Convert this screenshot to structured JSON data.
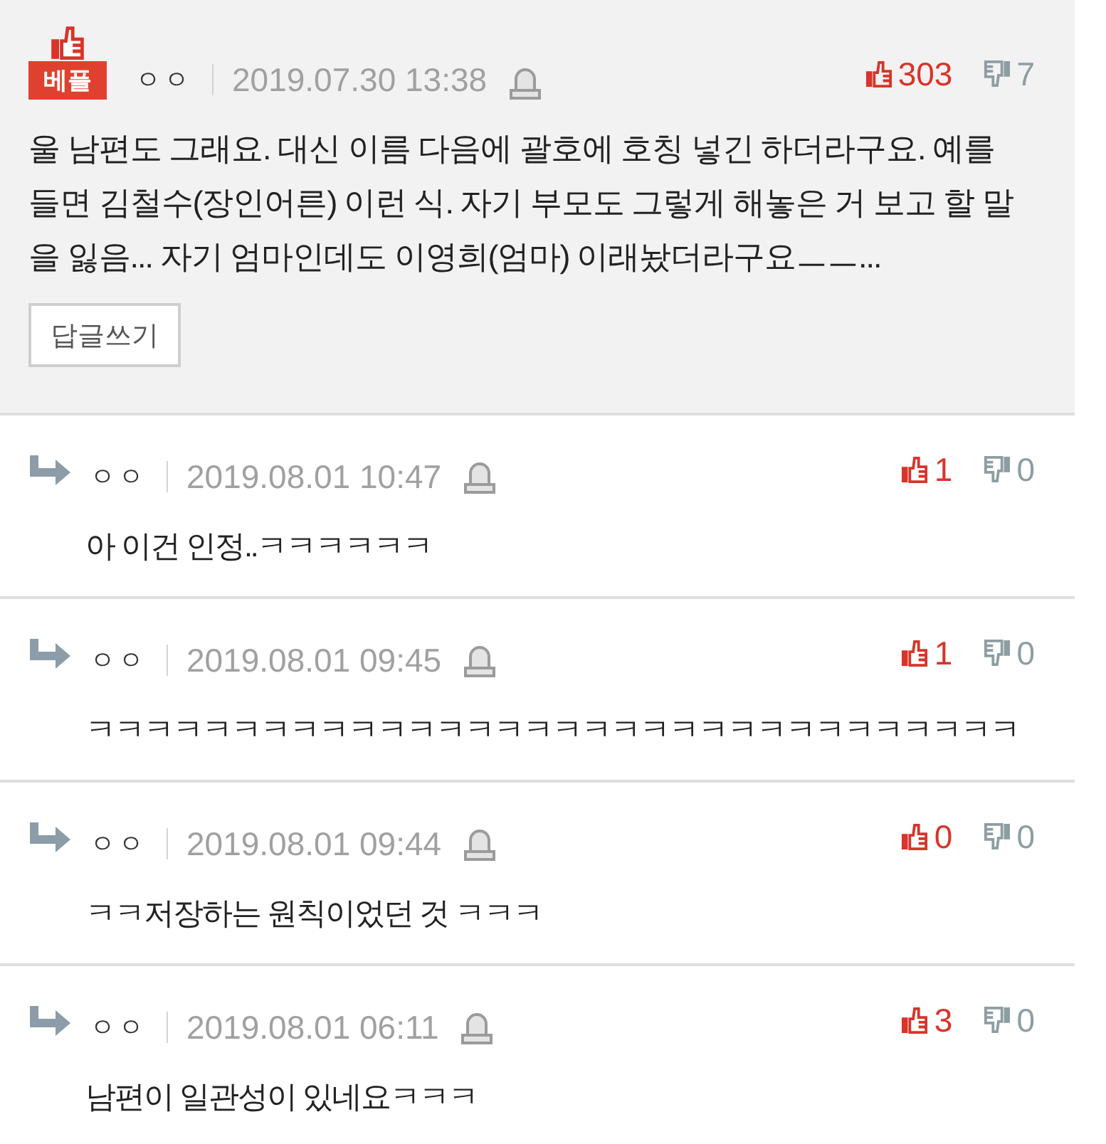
{
  "best_comment": {
    "badge": "베플",
    "author": "ㅇㅇ",
    "date": "2019.07.30 13:38",
    "likes": "303",
    "dislikes": "7",
    "text": "울 남편도 그래요. 대신 이름 다음에 괄호에 호칭 넣긴 하더라구요. 예를 들면 김철수(장인어른) 이런 식. 자기 부모도 그렇게 해놓은 거 보고 할 말을 잃음... 자기 엄마인데도 이영희(엄마) 이래놨더라구요ㅡㅡ...",
    "reply_button": "답글쓰기"
  },
  "replies": [
    {
      "author": "ㅇㅇ",
      "date": "2019.08.01 10:47",
      "likes": "1",
      "dislikes": "0",
      "text": "아 이건 인정..ㅋㅋㅋㅋㅋㅋ"
    },
    {
      "author": "ㅇㅇ",
      "date": "2019.08.01 09:45",
      "likes": "1",
      "dislikes": "0",
      "text": "ㅋㅋㅋㅋㅋㅋㅋㅋㅋㅋㅋㅋㅋㅋㅋㅋㅋㅋㅋㅋㅋㅋㅋㅋㅋㅋㅋㅋㅋㅋㅋㅋ"
    },
    {
      "author": "ㅇㅇ",
      "date": "2019.08.01 09:44",
      "likes": "0",
      "dislikes": "0",
      "text": "ㅋㅋ저장하는 원칙이었던 것 ㅋㅋㅋ"
    },
    {
      "author": "ㅇㅇ",
      "date": "2019.08.01 06:11",
      "likes": "3",
      "dislikes": "0",
      "text": "남편이 일관성이 있네요ㅋㅋㅋ"
    }
  ]
}
